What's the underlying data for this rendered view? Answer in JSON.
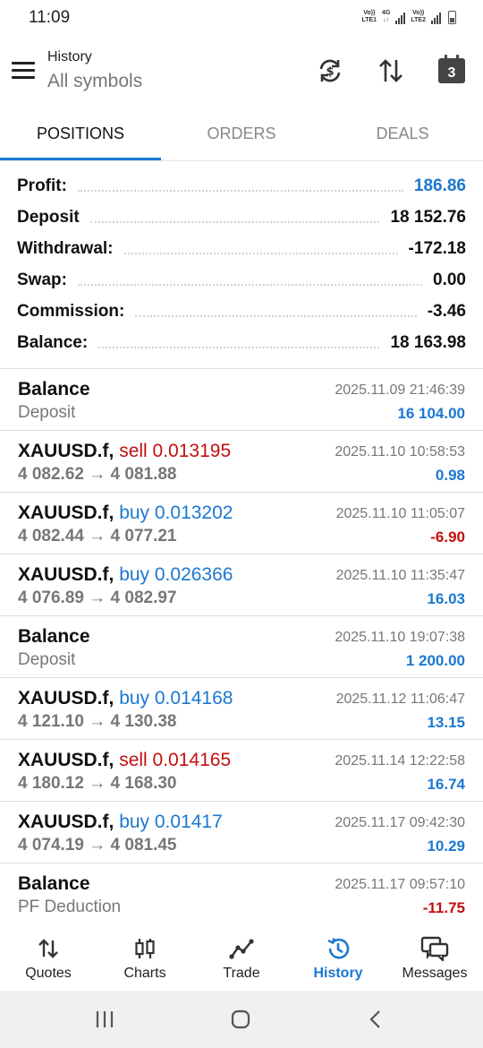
{
  "status_bar": {
    "time": "11:09",
    "sim1_tag_top": "Vo))",
    "sim1_tag_bottom": "LTE1",
    "net_type": "4G",
    "sim2_tag_top": "Vo))",
    "sim2_tag_bottom": "LTE2"
  },
  "header": {
    "title": "History",
    "subtitle": "All symbols",
    "calendar_day": "3"
  },
  "tabs": [
    {
      "label": "POSITIONS",
      "active": true
    },
    {
      "label": "ORDERS",
      "active": false
    },
    {
      "label": "DEALS",
      "active": false
    }
  ],
  "summary": {
    "profit_label": "Profit:",
    "profit_value": "186.86",
    "deposit_label": "Deposit",
    "deposit_value": "18 152.76",
    "withdrawal_label": "Withdrawal:",
    "withdrawal_value": "-172.18",
    "swap_label": "Swap:",
    "swap_value": "0.00",
    "commission_label": "Commission:",
    "commission_value": "-3.46",
    "balance_label": "Balance:",
    "balance_value": "18 163.98"
  },
  "arrow": "→",
  "items": [
    {
      "title": "Balance",
      "sub": "Deposit",
      "time": "2025.11.09 21:46:39",
      "value": "16 104.00"
    },
    {
      "symbol": "XAUUSD.f,",
      "dir": "sell 0.013195",
      "open": "4 082.62",
      "close": "4 081.88",
      "time": "2025.11.10 10:58:53",
      "value": "0.98"
    },
    {
      "symbol": "XAUUSD.f,",
      "dir": "buy 0.013202",
      "open": "4 082.44",
      "close": "4 077.21",
      "time": "2025.11.10 11:05:07",
      "value": "-6.90"
    },
    {
      "symbol": "XAUUSD.f,",
      "dir": "buy 0.026366",
      "open": "4 076.89",
      "close": "4 082.97",
      "time": "2025.11.10 11:35:47",
      "value": "16.03"
    },
    {
      "title": "Balance",
      "sub": "Deposit",
      "time": "2025.11.10 19:07:38",
      "value": "1 200.00"
    },
    {
      "symbol": "XAUUSD.f,",
      "dir": "buy 0.014168",
      "open": "4 121.10",
      "close": "4 130.38",
      "time": "2025.11.12 11:06:47",
      "value": "13.15"
    },
    {
      "symbol": "XAUUSD.f,",
      "dir": "sell 0.014165",
      "open": "4 180.12",
      "close": "4 168.30",
      "time": "2025.11.14 12:22:58",
      "value": "16.74"
    },
    {
      "symbol": "XAUUSD.f,",
      "dir": "buy 0.01417",
      "open": "4 074.19",
      "close": "4 081.45",
      "time": "2025.11.17 09:42:30",
      "value": "10.29"
    },
    {
      "title": "Balance",
      "sub": "PF Deduction",
      "time": "2025.11.17 09:57:10",
      "value": "-11.75"
    }
  ],
  "bottom_nav": [
    {
      "label": "Quotes",
      "icon": "quotes-icon"
    },
    {
      "label": "Charts",
      "icon": "charts-icon"
    },
    {
      "label": "Trade",
      "icon": "trade-icon"
    },
    {
      "label": "History",
      "icon": "history-icon",
      "active": true
    },
    {
      "label": "Messages",
      "icon": "messages-icon"
    }
  ],
  "colors": {
    "accent_blue": "#1b78d0",
    "loss_red": "#c40f0f",
    "muted_gray": "#777777"
  }
}
